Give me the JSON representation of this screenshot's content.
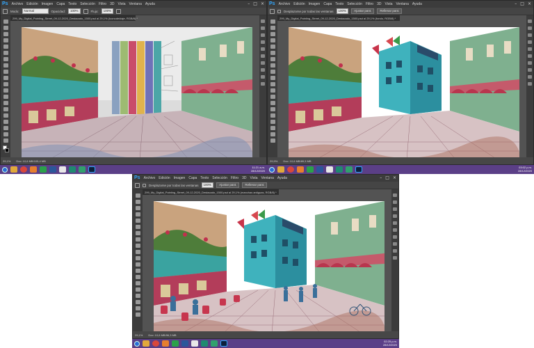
{
  "app": {
    "logo_text": "Ps",
    "menu": [
      "Archivo",
      "Edición",
      "Imagen",
      "Capa",
      "Texto",
      "Selección",
      "Filtro",
      "3D",
      "Vista",
      "Ventana",
      "Ayuda"
    ],
    "window_controls": [
      "–",
      "□",
      "×"
    ]
  },
  "screens": [
    {
      "id": "left",
      "options": {
        "mode_label": "Modo:",
        "mode_value": "Normal",
        "opacity_label": "Opacidad:",
        "opacity_value": "100%",
        "flow_label": "Flujo:",
        "flow_value": "100%"
      },
      "doc_tab": "299_My_Digital_Painting_Street_09-12-2020_Destacado_1500.psd al 29,1% (Iconodeidaje, RGB/8) *",
      "status": {
        "zoom": "29,1%",
        "doc": "Doc: 10,6 MB/105,4 MB"
      },
      "taskbar_clock": {
        "time": "11:21 a.m.",
        "date": "28/12/2020"
      }
    },
    {
      "id": "right",
      "options": {
        "scroll_all": "Desplazarse por todas las ventanas",
        "zoom_value": "100%",
        "fit_button": "Ajustar pant.",
        "fill_button": "Rellenar pant."
      },
      "doc_tab": "299_My_Digital_Painting_Street_09-12-2020_Destacado_1500.psd al 29,1% (fondo, RGB/8) *",
      "status": {
        "zoom": "29,9%",
        "doc": "Doc: 10,6 MB/89,5 MB"
      },
      "taskbar_clock": {
        "time": "03:02 p.m.",
        "date": "28/12/2020"
      }
    },
    {
      "id": "bottom",
      "options": {
        "scroll_all": "Desplazarse por todas las ventanas",
        "zoom_value": "100%",
        "fit_button": "Ajustar pant.",
        "fill_button": "Rellenar pant."
      },
      "doc_tab": "299_My_Digital_Painting_Street_09-12-2020_Destacado_1500.psd al 29,1% (manchas antiguas, RGB/8) *",
      "status": {
        "zoom": "29,1%",
        "doc": "Doc: 10,6 MB/96,3 MB"
      },
      "taskbar_clock": {
        "time": "02:25 p.m.",
        "date": "28/12/2020"
      }
    }
  ],
  "colors": {
    "ps_blue": "#31a8ff",
    "taskbar": "#5b3f87",
    "ui_dark": "#3c3c3c",
    "ui_mid": "#535353"
  }
}
